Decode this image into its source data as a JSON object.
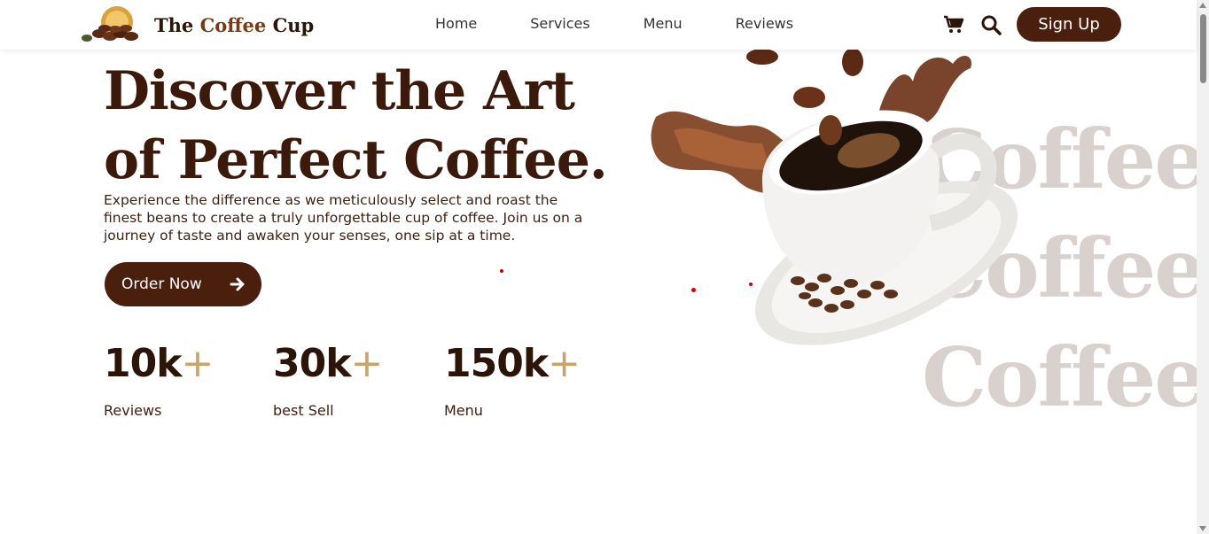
{
  "brand": {
    "name_part1": "The ",
    "name_part2": "Coffee",
    "name_part3": " Cup"
  },
  "nav": {
    "items": [
      "Home",
      "Services",
      "Menu",
      "Reviews"
    ]
  },
  "header": {
    "signup_label": "Sign Up",
    "icons": [
      "cart-icon",
      "search-icon"
    ]
  },
  "hero": {
    "title_line1": "Discover the Art",
    "title_line2": "of Perfect Coffee.",
    "description": "Experience the difference as we meticulously select and roast the finest beans to create a truly unforgettable cup of coffee. Join us on a journey of taste and awaken your senses, one sip at a time.",
    "cta_label": "Order Now"
  },
  "stats": [
    {
      "value": "10k",
      "plus": "+",
      "label": "Reviews"
    },
    {
      "value": "30k",
      "plus": "+",
      "label": "best Sell"
    },
    {
      "value": "150k",
      "plus": "+",
      "label": "Menu"
    }
  ],
  "background_words": [
    "Coffee",
    "Coffee",
    "Coffee"
  ],
  "colors": {
    "primary": "#4a1f0e",
    "accent": "#c7a46a",
    "bg_word": "#d9d1cd"
  }
}
